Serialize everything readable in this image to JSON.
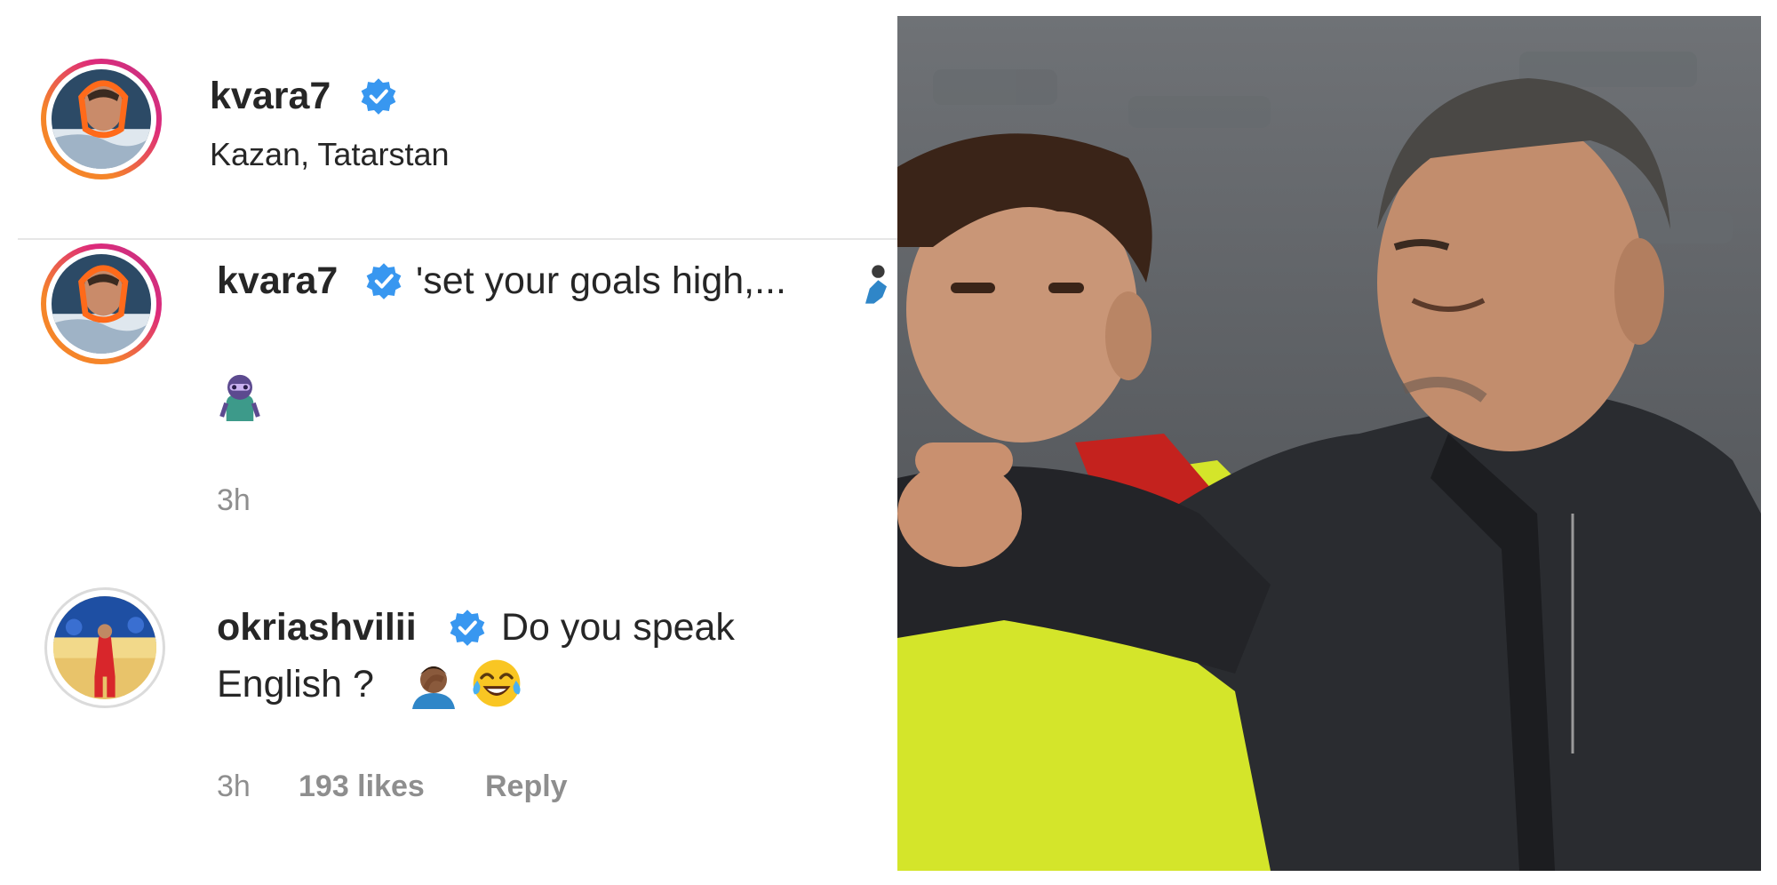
{
  "post": {
    "username": "kvara7",
    "location": "Kazan, Tatarstan"
  },
  "caption": {
    "username": "kvara7",
    "text": "'set your goals high,...",
    "time": "3h"
  },
  "comment": {
    "username": "okriashvilii",
    "line1": "Do you speak",
    "line2": "English ?",
    "time": "3h",
    "likes": "193 likes",
    "reply": "Reply"
  },
  "icons": {
    "verified": "verified-badge-icon",
    "emoji_caption": "ninja-emoji-icon",
    "emoji_facepalm": "facepalm-emoji-icon",
    "emoji_laugh": "tears-of-joy-emoji-icon"
  },
  "colors": {
    "verified_blue": "#3897f0",
    "secondary_text": "#8e8e8e",
    "story_ring_start": "#f58529",
    "story_ring_end": "#c13584"
  }
}
